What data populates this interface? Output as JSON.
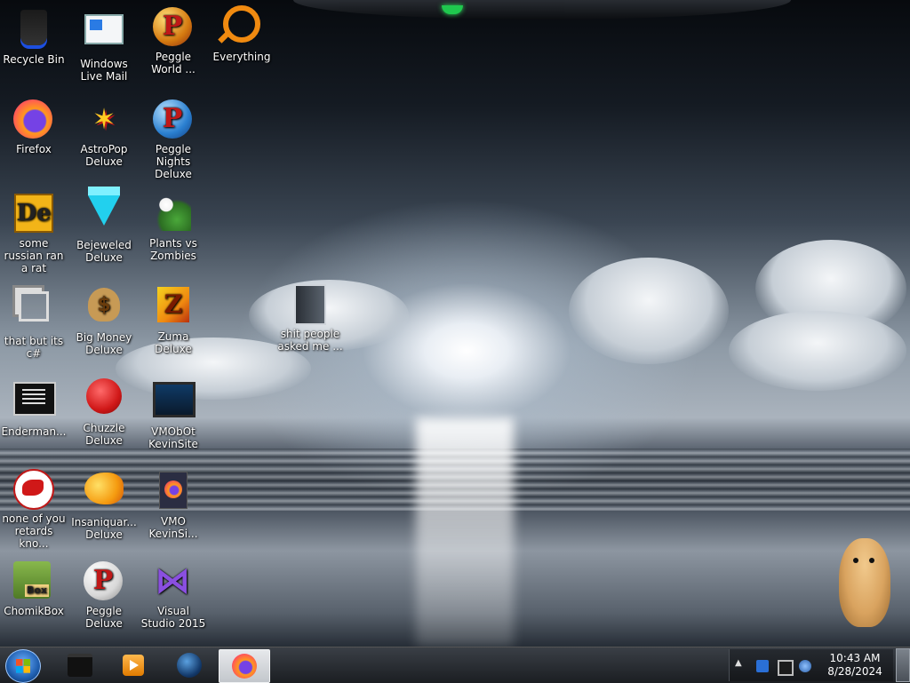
{
  "desktop": {
    "icons": [
      {
        "label": "Recycle Bin",
        "icon": "recycle-bin-icon"
      },
      {
        "label": "Windows Live Mail",
        "icon": "mail-icon"
      },
      {
        "label": "Peggle World ...",
        "icon": "peggle-world-icon"
      },
      {
        "label": "Everything",
        "icon": "search-icon"
      },
      {
        "label": "Firefox",
        "icon": "firefox-icon"
      },
      {
        "label": "AstroPop Deluxe",
        "icon": "astropop-icon"
      },
      {
        "label": "Peggle Nights Deluxe",
        "icon": "peggle-nights-icon"
      },
      {
        "label": "some russian ran a rat",
        "icon": "de-icon"
      },
      {
        "label": "Bejeweled Deluxe",
        "icon": "gem-icon"
      },
      {
        "label": "Plants vs Zombies",
        "icon": "plants-vs-zombies-icon"
      },
      {
        "label": "that but its c#",
        "icon": "copy-windows-icon"
      },
      {
        "label": "Big Money Deluxe",
        "icon": "money-bag-icon"
      },
      {
        "label": "Zuma Deluxe",
        "icon": "zuma-icon"
      },
      {
        "label": "shit people asked me ...",
        "icon": "document-icon"
      },
      {
        "label": "Enderman...",
        "icon": "terminal-icon"
      },
      {
        "label": "Chuzzle Deluxe",
        "icon": "chuzzle-icon"
      },
      {
        "label": "VMObOt KevinSite",
        "icon": "monitor-icon"
      },
      {
        "label": "none of you retards kno...",
        "icon": "red-bird-icon"
      },
      {
        "label": "Insaniquar... Deluxe",
        "icon": "fish-icon"
      },
      {
        "label": "VMO KevinSi...",
        "icon": "firefox-document-icon"
      },
      {
        "label": "ChomikBox",
        "icon": "chomikbox-icon"
      },
      {
        "label": "Peggle Deluxe",
        "icon": "peggle-icon"
      },
      {
        "label": "Visual Studio 2015",
        "icon": "visual-studio-icon"
      }
    ],
    "chomikbox_badge": "Box",
    "decorations": {
      "hamster": "hamster-mascot-icon"
    }
  },
  "taskbar": {
    "start": "start-orb-icon",
    "pinned": [
      {
        "name": "file-explorer",
        "icon": "folder-icon",
        "active": false
      },
      {
        "name": "media-player",
        "icon": "media-player-icon",
        "active": false
      },
      {
        "name": "browser-globe",
        "icon": "globe-icon",
        "active": false
      },
      {
        "name": "firefox",
        "icon": "firefox-icon",
        "active": true
      }
    ],
    "tray": {
      "overflow": "▲",
      "icons": [
        "network-icon",
        "display-icon",
        "sync-icon"
      ],
      "time": "10:43 AM",
      "date": "8/28/2024"
    }
  },
  "colors": {
    "taskbar": "#1b1e22",
    "accent": "#22dd55"
  }
}
